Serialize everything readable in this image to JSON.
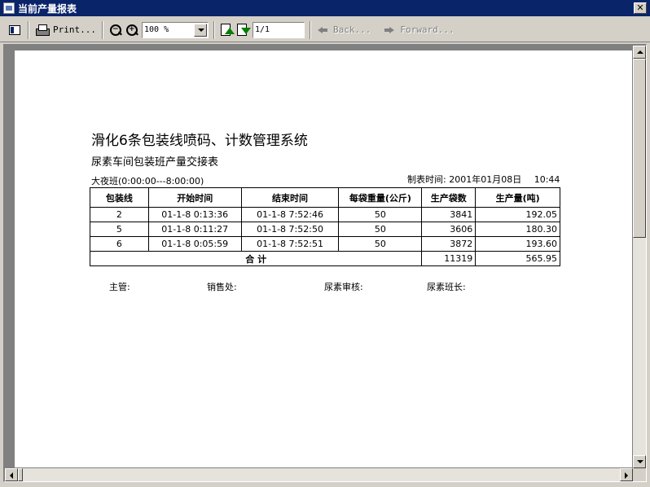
{
  "window": {
    "title": "当前产量报表",
    "close_label": "✕"
  },
  "toolbar": {
    "print_label": "Print...",
    "zoom_value": "100 %",
    "page_value": "1/1",
    "back_label": "Back...",
    "forward_label": "Forward..."
  },
  "report": {
    "title": "滑化6条包装线喷码、计数管理系统",
    "subtitle": "尿素车间包装班产量交接表",
    "shift": "大夜班(0:00:00---8:00:00)",
    "date_label": "制表时间:",
    "date_value": "2001年01月08日",
    "time_value": "10:44",
    "columns": [
      "包装线",
      "开始时间",
      "结束时间",
      "每袋重量(公斤)",
      "生产袋数",
      "生产量(吨)"
    ],
    "rows": [
      [
        "2",
        "01-1-8  0:13:36",
        "01-1-8  7:52:46",
        "50",
        "3841",
        "192.05"
      ],
      [
        "5",
        "01-1-8  0:11:27",
        "01-1-8  7:52:50",
        "50",
        "3606",
        "180.30"
      ],
      [
        "6",
        "01-1-8  0:05:59",
        "01-1-8  7:52:51",
        "50",
        "3872",
        "193.60"
      ]
    ],
    "total_label": "合    计",
    "total_bags": "11319",
    "total_output": "565.95",
    "signatures": [
      "主管:",
      "销售处:",
      "尿素审核:",
      "尿素班长:"
    ]
  }
}
